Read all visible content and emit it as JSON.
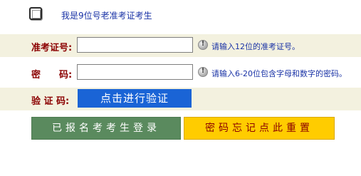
{
  "candidate_check": {
    "label": "我是9位号老准考证考生"
  },
  "exam_number": {
    "label": "准考证号:",
    "value": "",
    "hint": "请输入12位的准考证号。"
  },
  "password": {
    "label": "密　　码:",
    "value": "",
    "hint": "请输入6-20位包含字母和数字的密码。"
  },
  "verify": {
    "label": "验 证 码:",
    "button_label": "点击进行验证"
  },
  "actions": {
    "login_label": "已报名考考生登录",
    "reset_label": "密码忘记点此重置"
  },
  "colors": {
    "label_red": "#8b0000",
    "hint_blue": "#1a33a6",
    "row_shade": "#f3f1df",
    "verify_blue": "#1a64d6",
    "login_green": "#5a8a5e",
    "reset_yellow": "#ffcc00"
  },
  "icons": {
    "hint": "info-icon"
  }
}
